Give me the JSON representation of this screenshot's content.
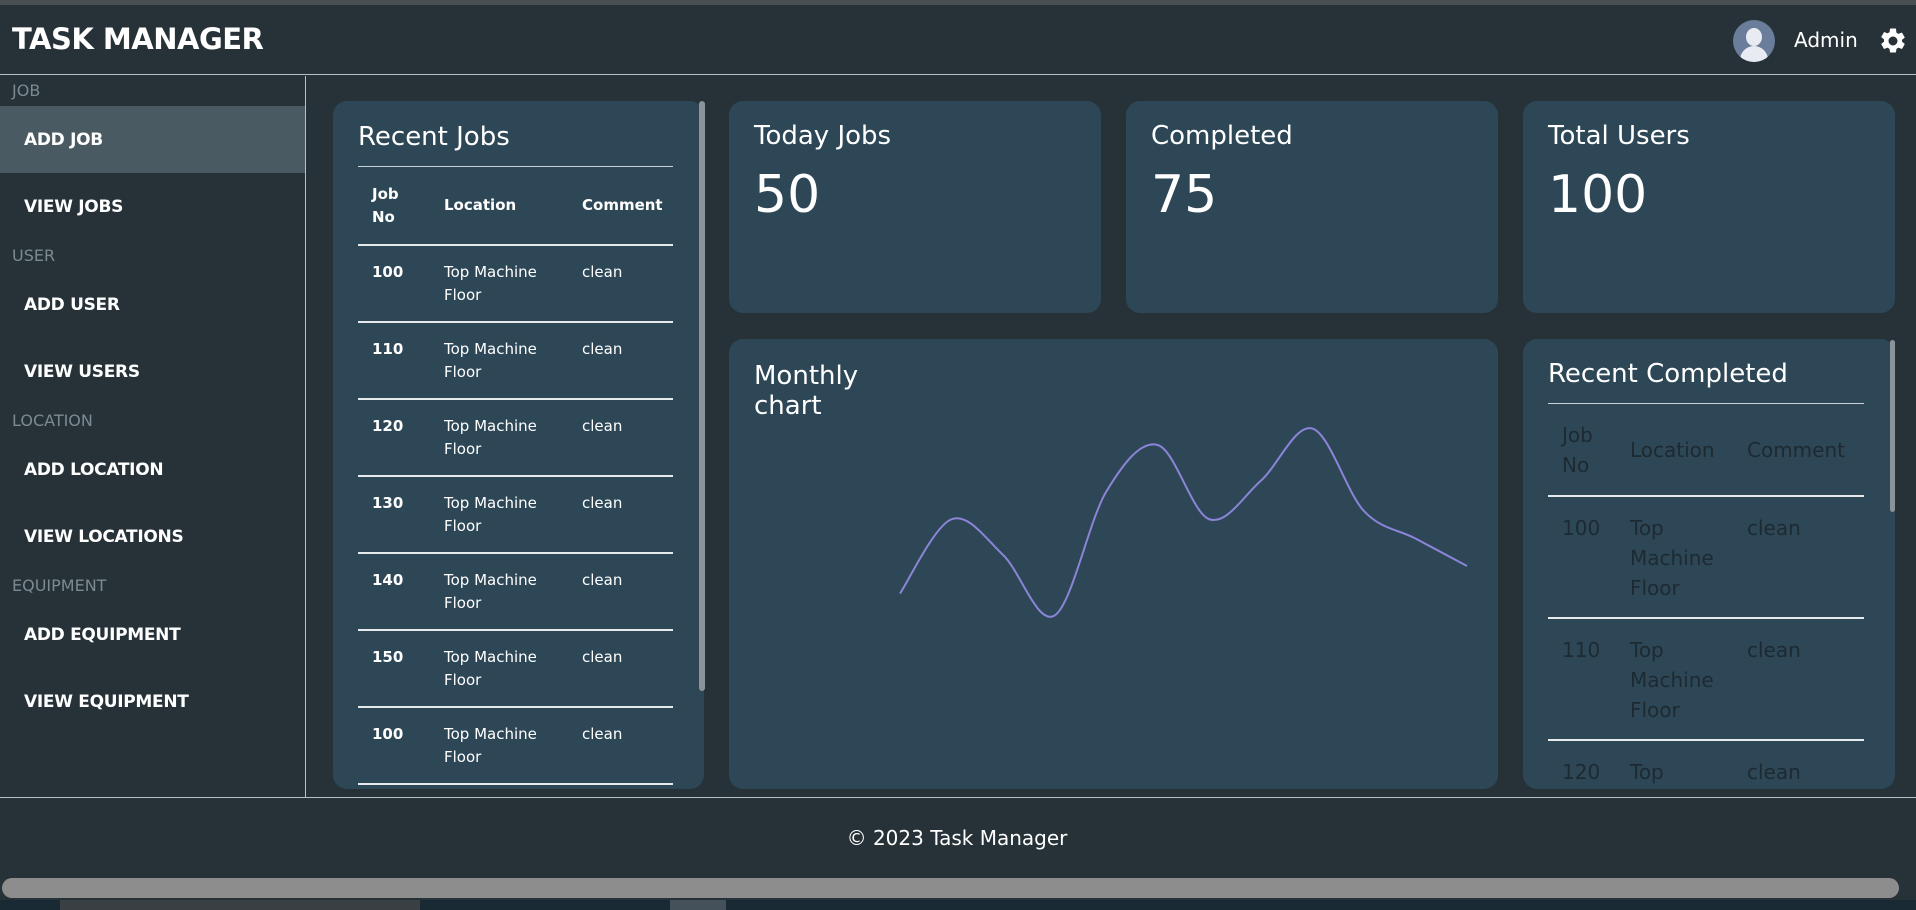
{
  "header": {
    "title": "TASK MANAGER",
    "user_name": "Admin"
  },
  "sidebar": {
    "sections": [
      {
        "label": "JOB",
        "items": [
          {
            "label": "ADD JOB",
            "active": true
          },
          {
            "label": "VIEW JOBS"
          }
        ]
      },
      {
        "label": "USER",
        "items": [
          {
            "label": "ADD USER"
          },
          {
            "label": "VIEW USERS"
          }
        ]
      },
      {
        "label": "LOCATION",
        "items": [
          {
            "label": "ADD LOCATION"
          },
          {
            "label": "VIEW LOCATIONS"
          }
        ]
      },
      {
        "label": "EQUIPMENT",
        "items": [
          {
            "label": "ADD EQUIPMENT"
          },
          {
            "label": "VIEW EQUIPMENT"
          }
        ]
      }
    ]
  },
  "recent_jobs": {
    "title": "Recent Jobs",
    "columns": [
      "Job No",
      "Location",
      "Comment"
    ],
    "rows": [
      {
        "job_no": "100",
        "location": "Top Machine Floor",
        "comment": "clean"
      },
      {
        "job_no": "110",
        "location": "Top Machine Floor",
        "comment": "clean"
      },
      {
        "job_no": "120",
        "location": "Top Machine Floor",
        "comment": "clean"
      },
      {
        "job_no": "130",
        "location": "Top Machine Floor",
        "comment": "clean"
      },
      {
        "job_no": "140",
        "location": "Top Machine Floor",
        "comment": "clean"
      },
      {
        "job_no": "150",
        "location": "Top Machine Floor",
        "comment": "clean"
      },
      {
        "job_no": "100",
        "location": "Top Machine Floor",
        "comment": "clean"
      }
    ]
  },
  "stats": {
    "today_jobs": {
      "label": "Today Jobs",
      "value": "50"
    },
    "completed": {
      "label": "Completed",
      "value": "75"
    },
    "total_users": {
      "label": "Total Users",
      "value": "100"
    }
  },
  "monthly_chart": {
    "title": "Monthly chart",
    "line_color": "#8b84d7"
  },
  "chart_data": {
    "type": "line",
    "title": "Monthly chart",
    "xlabel": "",
    "ylabel": "",
    "grid": false,
    "x": [
      1,
      2,
      3,
      4,
      5,
      6,
      7,
      8,
      9,
      10,
      11,
      12
    ],
    "values": [
      22,
      49,
      36,
      14,
      59,
      76,
      49,
      63,
      82,
      52,
      42,
      32
    ],
    "ylim": [
      0,
      100
    ]
  },
  "recent_completed": {
    "title": "Recent Completed",
    "columns": [
      "Job No",
      "Location",
      "Comment"
    ],
    "rows": [
      {
        "job_no": "100",
        "location": "Top Machine Floor",
        "comment": "clean"
      },
      {
        "job_no": "110",
        "location": "Top Machine Floor",
        "comment": "clean"
      },
      {
        "job_no": "120",
        "location": "Top",
        "comment": "clean"
      }
    ]
  },
  "footer": {
    "text": "© 2023 Task Manager"
  },
  "colors": {
    "background": "#263238",
    "card": "#2d4757",
    "active_item": "#4a5a63",
    "chart_line": "#8b84d7"
  },
  "icons": [
    "avatar",
    "gear-icon"
  ]
}
